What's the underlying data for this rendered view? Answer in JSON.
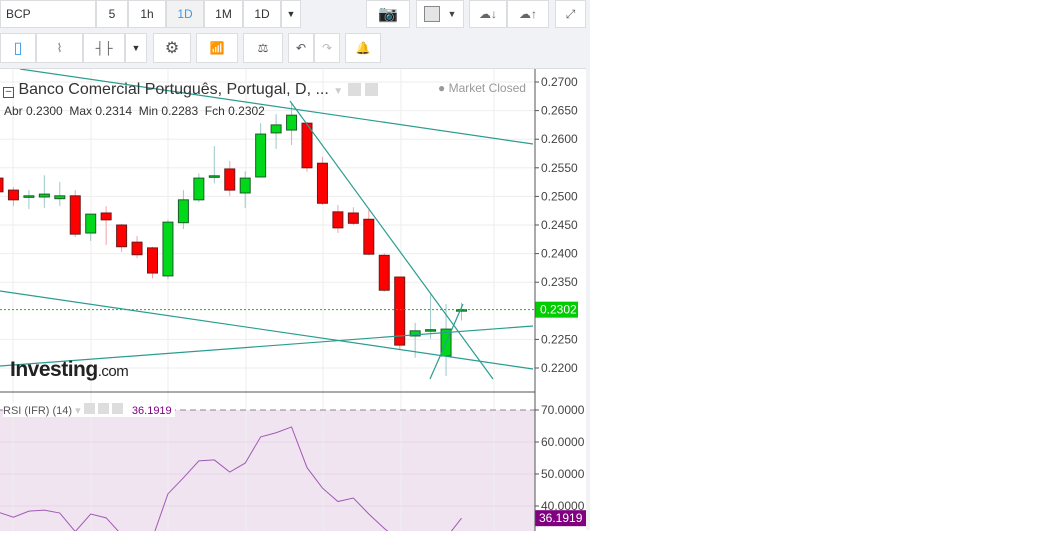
{
  "toolbar": {
    "symbol": "BCP",
    "intervals": [
      "5",
      "1h",
      "1D",
      "1M",
      "1D"
    ],
    "active_interval": "1D"
  },
  "legend": {
    "title": "Banco Comercial Português, Portugal, D, ...",
    "status": "Market Closed",
    "ohlc": "Abr 0.2300  Max 0.2314  Min 0.2283  Fch 0.2302"
  },
  "rsi": {
    "label": "RSI (IFR) (14)",
    "value": "36.1919"
  },
  "colors": {
    "up": "#00d91a",
    "down": "#ff0000",
    "trend": "#2a9d8f",
    "rsi": "#a05ab4",
    "rsi_bg": "#f0e4f1",
    "price": "#00cc00"
  },
  "logo": "Investing.com",
  "chart_data": {
    "type": "candlestick",
    "price_axis": {
      "ticks": [
        "0.2700",
        "0.2650",
        "0.2600",
        "0.2550",
        "0.2500",
        "0.2450",
        "0.2400",
        "0.2350",
        "0.2250",
        "0.2200"
      ],
      "range": [
        0.2159,
        0.2714
      ]
    },
    "last_price": "0.2302",
    "candles": [
      [
        0.2532,
        0.254,
        0.2505,
        0.2508
      ],
      [
        0.2511,
        0.2516,
        0.2483,
        0.2494
      ],
      [
        0.2501,
        0.2511,
        0.2478,
        0.2501
      ],
      [
        0.2499,
        0.2537,
        0.248,
        0.2504
      ],
      [
        0.2496,
        0.2525,
        0.2483,
        0.2501
      ],
      [
        0.2501,
        0.2511,
        0.2429,
        0.2434
      ],
      [
        0.2436,
        0.2469,
        0.2422,
        0.2469
      ],
      [
        0.2471,
        0.2483,
        0.2415,
        0.2459
      ],
      [
        0.245,
        0.2452,
        0.2403,
        0.2412
      ],
      [
        0.242,
        0.2431,
        0.2392,
        0.2398
      ],
      [
        0.241,
        0.2412,
        0.2357,
        0.2366
      ],
      [
        0.2361,
        0.2459,
        0.2355,
        0.2455
      ],
      [
        0.2454,
        0.2511,
        0.2443,
        0.2494
      ],
      [
        0.2494,
        0.254,
        0.249,
        0.2532
      ],
      [
        0.2536,
        0.2588,
        0.2523,
        0.2536
      ],
      [
        0.2548,
        0.2562,
        0.2501,
        0.2511
      ],
      [
        0.2506,
        0.2544,
        0.248,
        0.2532
      ],
      [
        0.2534,
        0.2628,
        0.2534,
        0.2609
      ],
      [
        0.2611,
        0.2644,
        0.2583,
        0.2625
      ],
      [
        0.2616,
        0.2663,
        0.259,
        0.2642
      ],
      [
        0.2628,
        0.263,
        0.2543,
        0.255
      ],
      [
        0.2558,
        0.2569,
        0.2485,
        0.2488
      ],
      [
        0.2473,
        0.2485,
        0.2436,
        0.2445
      ],
      [
        0.2471,
        0.2481,
        0.245,
        0.2453
      ],
      [
        0.246,
        0.2476,
        0.2397,
        0.2399
      ],
      [
        0.2397,
        0.2401,
        0.2333,
        0.2336
      ],
      [
        0.2359,
        0.236,
        0.2231,
        0.224
      ],
      [
        0.2256,
        0.2279,
        0.2218,
        0.2265
      ],
      [
        0.2267,
        0.2329,
        0.2251,
        0.2267
      ],
      [
        0.2221,
        0.2312,
        0.2186,
        0.2268
      ],
      [
        0.23,
        0.2314,
        0.2283,
        0.2302
      ]
    ],
    "rsi_axis": {
      "ticks": [
        "70.0000",
        "60.0000",
        "50.0000",
        "40.0000"
      ],
      "range": [
        30,
        75
      ]
    },
    "rsi_values": [
      38.1,
      36.5,
      38.4,
      38.7,
      37.8,
      32,
      37.5,
      36.3,
      31,
      28,
      30,
      43.8,
      48.8,
      54.1,
      54.4,
      50.6,
      53.4,
      61.6,
      62.9,
      64.7,
      52,
      45.6,
      41.4,
      42.5,
      37.5,
      33,
      29,
      25,
      26,
      30,
      36.19
    ]
  }
}
